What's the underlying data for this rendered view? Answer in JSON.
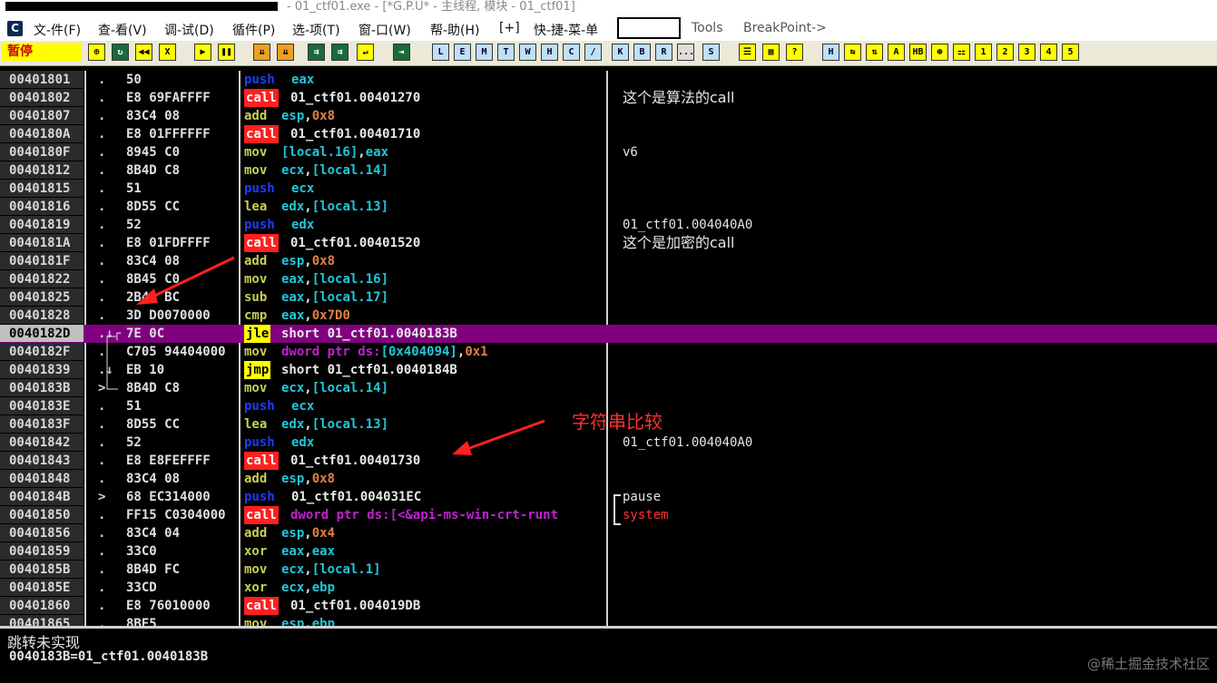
{
  "window": {
    "title": "- 01_ctf01.exe - [*G.P.U* - 主线程, 模块 - 01_ctf01]"
  },
  "menu": {
    "app_icon": "C",
    "items": [
      "文-件(F)",
      "查-看(V)",
      "调-试(D)",
      "循件(P)",
      "选-项(T)",
      "窗-口(W)",
      "帮-助(H)",
      "[+]",
      "快-捷-菜-单"
    ],
    "tools": "Tools",
    "breakpoint": "BreakPoint->"
  },
  "toolbar": {
    "status": "暂停",
    "buttons": [
      "⊕",
      "↻",
      "◀◀",
      "X",
      "▶",
      "❚❚",
      "⇊",
      "⇊",
      "⇉",
      "⇉",
      "↵",
      "⇥",
      "L",
      "E",
      "M",
      "T",
      "W",
      "H",
      "C",
      "/",
      "K",
      "B",
      "R",
      "...",
      "S",
      "☰",
      "▦",
      "?",
      "H",
      "⇆",
      "⇅",
      "A",
      "HB",
      "⊛",
      "⚏",
      "1",
      "2",
      "3",
      "4",
      "5"
    ]
  },
  "disasm": [
    {
      "addr": "00401801",
      "gut": ".",
      "hex": "50",
      "mn": "push",
      "ops": [
        [
          "reg",
          "eax"
        ]
      ]
    },
    {
      "addr": "00401802",
      "gut": ".",
      "hex": "E8 69FAFFFF",
      "mn": "call",
      "ops": [
        [
          "txt",
          "01_ctf01.00401270"
        ]
      ],
      "cmt": "这个是算法的call",
      "cmtzh": true
    },
    {
      "addr": "00401807",
      "gut": ".",
      "hex": "83C4 08",
      "mn": "add",
      "ops": [
        [
          "reg",
          "esp"
        ],
        [
          "txt",
          ","
        ],
        [
          "num",
          "0x8"
        ]
      ]
    },
    {
      "addr": "0040180A",
      "gut": ".",
      "hex": "E8 01FFFFFF",
      "mn": "call",
      "ops": [
        [
          "txt",
          "01_ctf01.00401710"
        ]
      ]
    },
    {
      "addr": "0040180F",
      "gut": ".",
      "hex": "8945 C0",
      "mn": "mov",
      "ops": [
        [
          "reg",
          "[local.16]"
        ],
        [
          "txt",
          ","
        ],
        [
          "reg",
          "eax"
        ]
      ],
      "cmt": "v6"
    },
    {
      "addr": "00401812",
      "gut": ".",
      "hex": "8B4D C8",
      "mn": "mov",
      "ops": [
        [
          "reg",
          "ecx"
        ],
        [
          "txt",
          ","
        ],
        [
          "reg",
          "[local.14]"
        ]
      ]
    },
    {
      "addr": "00401815",
      "gut": ".",
      "hex": "51",
      "mn": "push",
      "ops": [
        [
          "reg",
          "ecx"
        ]
      ]
    },
    {
      "addr": "00401816",
      "gut": ".",
      "hex": "8D55 CC",
      "mn": "lea",
      "ops": [
        [
          "reg",
          "edx"
        ],
        [
          "txt",
          ","
        ],
        [
          "reg",
          "[local.13]"
        ]
      ]
    },
    {
      "addr": "00401819",
      "gut": ".",
      "hex": "52",
      "mn": "push",
      "ops": [
        [
          "reg",
          "edx"
        ]
      ],
      "cmt": "01_ctf01.004040A0"
    },
    {
      "addr": "0040181A",
      "gut": ".",
      "hex": "E8 01FDFFFF",
      "mn": "call",
      "ops": [
        [
          "txt",
          "01_ctf01.00401520"
        ]
      ],
      "cmt": "这个是加密的call",
      "cmtzh": true
    },
    {
      "addr": "0040181F",
      "gut": ".",
      "hex": "83C4 08",
      "mn": "add",
      "ops": [
        [
          "reg",
          "esp"
        ],
        [
          "txt",
          ","
        ],
        [
          "num",
          "0x8"
        ]
      ]
    },
    {
      "addr": "00401822",
      "gut": ".",
      "hex": "8B45 C0",
      "mn": "mov",
      "ops": [
        [
          "reg",
          "eax"
        ],
        [
          "txt",
          ","
        ],
        [
          "reg",
          "[local.16]"
        ]
      ]
    },
    {
      "addr": "00401825",
      "gut": ".",
      "hex": "2B45 BC",
      "mn": "sub",
      "ops": [
        [
          "reg",
          "eax"
        ],
        [
          "txt",
          ","
        ],
        [
          "reg",
          "[local.17]"
        ]
      ]
    },
    {
      "addr": "00401828",
      "gut": ".",
      "hex": "3D D0070000",
      "mn": "cmp",
      "ops": [
        [
          "reg",
          "eax"
        ],
        [
          "txt",
          ","
        ],
        [
          "num",
          "0x7D0"
        ]
      ]
    },
    {
      "addr": "0040182D",
      "gut": ".↓┌",
      "hex": "7E 0C",
      "mn": "jle",
      "ops": [
        [
          "txt",
          "short 01_ctf01.0040183B"
        ]
      ],
      "sel": true
    },
    {
      "addr": "0040182F",
      "gut": ".",
      "hex": "C705 94404000",
      "mn": "mov",
      "ops": [
        [
          "ptr",
          "dword ptr ds:"
        ],
        [
          "reg",
          "[0x404094]"
        ],
        [
          "txt",
          ","
        ],
        [
          "num",
          "0x1"
        ]
      ]
    },
    {
      "addr": "00401839",
      "gut": ".↓",
      "hex": "EB 10",
      "mn": "jmp",
      "ops": [
        [
          "txt",
          "short 01_ctf01.0040184B"
        ]
      ]
    },
    {
      "addr": "0040183B",
      "gut": ">",
      "hex": "8B4D C8",
      "mn": "mov",
      "ops": [
        [
          "reg",
          "ecx"
        ],
        [
          "txt",
          ","
        ],
        [
          "reg",
          "[local.14]"
        ]
      ]
    },
    {
      "addr": "0040183E",
      "gut": ".",
      "hex": "51",
      "mn": "push",
      "ops": [
        [
          "reg",
          "ecx"
        ]
      ]
    },
    {
      "addr": "0040183F",
      "gut": ".",
      "hex": "8D55 CC",
      "mn": "lea",
      "ops": [
        [
          "reg",
          "edx"
        ],
        [
          "txt",
          ","
        ],
        [
          "reg",
          "[local.13]"
        ]
      ]
    },
    {
      "addr": "00401842",
      "gut": ".",
      "hex": "52",
      "mn": "push",
      "ops": [
        [
          "reg",
          "edx"
        ]
      ],
      "cmt": "01_ctf01.004040A0"
    },
    {
      "addr": "00401843",
      "gut": ".",
      "hex": "E8 E8FEFFFF",
      "mn": "call",
      "ops": [
        [
          "txt",
          "01_ctf01.00401730"
        ]
      ]
    },
    {
      "addr": "00401848",
      "gut": ".",
      "hex": "83C4 08",
      "mn": "add",
      "ops": [
        [
          "reg",
          "esp"
        ],
        [
          "txt",
          ","
        ],
        [
          "num",
          "0x8"
        ]
      ]
    },
    {
      "addr": "0040184B",
      "gut": ">",
      "hex": "68 EC314000",
      "mn": "push",
      "ops": [
        [
          "txt",
          "01_ctf01.004031EC"
        ]
      ],
      "cmt": "pause"
    },
    {
      "addr": "00401850",
      "gut": ".",
      "hex": "FF15 C0304000",
      "mn": "call",
      "ops": [
        [
          "ptr",
          "dword ptr ds:[<&api-ms-win-crt-runt"
        ]
      ],
      "cmt": "system",
      "cmtred": true
    },
    {
      "addr": "00401856",
      "gut": ".",
      "hex": "83C4 04",
      "mn": "add",
      "ops": [
        [
          "reg",
          "esp"
        ],
        [
          "txt",
          ","
        ],
        [
          "num",
          "0x4"
        ]
      ]
    },
    {
      "addr": "00401859",
      "gut": ".",
      "hex": "33C0",
      "mn": "xor",
      "ops": [
        [
          "reg",
          "eax"
        ],
        [
          "txt",
          ","
        ],
        [
          "reg",
          "eax"
        ]
      ]
    },
    {
      "addr": "0040185B",
      "gut": ".",
      "hex": "8B4D FC",
      "mn": "mov",
      "ops": [
        [
          "reg",
          "ecx"
        ],
        [
          "txt",
          ","
        ],
        [
          "reg",
          "[local.1]"
        ]
      ]
    },
    {
      "addr": "0040185E",
      "gut": ".",
      "hex": "33CD",
      "mn": "xor",
      "ops": [
        [
          "reg",
          "ecx"
        ],
        [
          "txt",
          ","
        ],
        [
          "reg",
          "ebp"
        ]
      ]
    },
    {
      "addr": "00401860",
      "gut": ".",
      "hex": "E8 76010000",
      "mn": "call",
      "ops": [
        [
          "txt",
          "01_ctf01.004019DB"
        ]
      ]
    },
    {
      "addr": "00401865",
      "gut": ".",
      "hex": "8BE5",
      "mn": "mov",
      "ops": [
        [
          "reg",
          "esp"
        ],
        [
          "txt",
          ","
        ],
        [
          "reg",
          "ebp"
        ]
      ]
    }
  ],
  "annotation": {
    "text": "字符串比较"
  },
  "info": {
    "line1": "跳转未实现",
    "line2": "0040183B=01_ctf01.0040183B"
  },
  "watermark": "@稀土掘金技术社区"
}
